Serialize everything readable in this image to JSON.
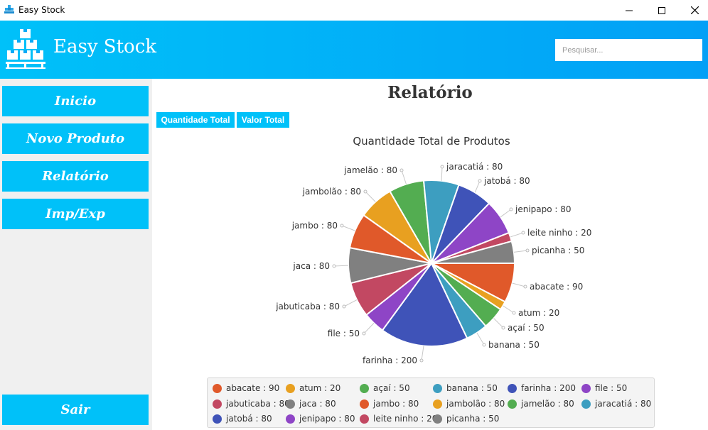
{
  "window": {
    "title": "Easy Stock"
  },
  "header": {
    "brand": "Easy Stock",
    "search_placeholder": "Pesquisar..."
  },
  "sidebar": {
    "items": [
      {
        "label": "Inicio",
        "name": "sidebar-item-inicio"
      },
      {
        "label": "Novo Produto",
        "name": "sidebar-item-novo-produto"
      },
      {
        "label": "Relatório",
        "name": "sidebar-item-relatorio"
      },
      {
        "label": "Imp/Exp",
        "name": "sidebar-item-imp-exp"
      }
    ],
    "exit_label": "Sair"
  },
  "main": {
    "title": "Relatório",
    "tabs": [
      {
        "label": "Quantidade Total"
      },
      {
        "label": "Valor Total"
      }
    ]
  },
  "chart_data": {
    "type": "pie",
    "title": "Quantidade Total de Produtos",
    "start_angle_deg": 0,
    "direction": "clockwise",
    "legend_position": "bottom",
    "slices": [
      {
        "label": "abacate",
        "value": 90,
        "color": "#e0592a",
        "text": "abacate : 90"
      },
      {
        "label": "atum",
        "value": 20,
        "color": "#e8a020",
        "text": "atum : 20"
      },
      {
        "label": "açaí",
        "value": 50,
        "color": "#53ad51",
        "text": "açaí : 50"
      },
      {
        "label": "banana",
        "value": 50,
        "color": "#3d9ec0",
        "text": "banana : 50"
      },
      {
        "label": "farinha",
        "value": 200,
        "color": "#3f53b8",
        "text": "farinha : 200"
      },
      {
        "label": "file",
        "value": 50,
        "color": "#8e45c6",
        "text": "file : 50"
      },
      {
        "label": "jabuticaba",
        "value": 80,
        "color": "#c24862",
        "text": "jabuticaba : 80"
      },
      {
        "label": "jaca",
        "value": 80,
        "color": "#808080",
        "text": "jaca : 80"
      },
      {
        "label": "jambo",
        "value": 80,
        "color": "#e0592a",
        "text": "jambo : 80"
      },
      {
        "label": "jambolão",
        "value": 80,
        "color": "#e8a020",
        "text": "jambolão : 80"
      },
      {
        "label": "jamelão",
        "value": 80,
        "color": "#53ad51",
        "text": "jamelão : 80"
      },
      {
        "label": "jaracatiá",
        "value": 80,
        "color": "#3d9ec0",
        "text": "jaracatiá : 80"
      },
      {
        "label": "jatobá",
        "value": 80,
        "color": "#3f53b8",
        "text": "jatobá : 80"
      },
      {
        "label": "jenipapo",
        "value": 80,
        "color": "#8e45c6",
        "text": "jenipapo : 80"
      },
      {
        "label": "leite ninho",
        "value": 20,
        "color": "#c24862",
        "text": "leite ninho : 20"
      },
      {
        "label": "picanha",
        "value": 50,
        "color": "#808080",
        "text": "picanha : 50"
      }
    ]
  }
}
